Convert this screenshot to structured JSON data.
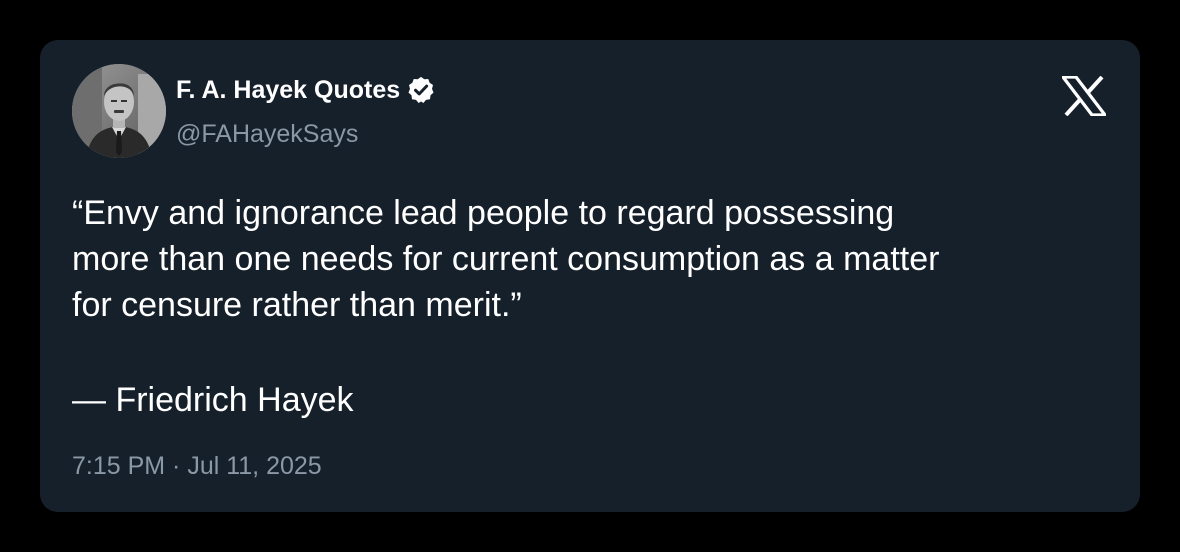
{
  "tweet": {
    "author": {
      "display_name": "F. A. Hayek Quotes",
      "handle": "@FAHayekSays",
      "verified": true,
      "avatar_icon": "profile-photo"
    },
    "brand_icon": "x-logo-icon",
    "quote": "“Envy and ignorance lead people to regard possessing\nmore than one needs for current consumption as a matter\nfor censure rather than merit.”",
    "attribution": "— Friedrich Hayek",
    "timestamp": "7:15 PM · Jul 11, 2025"
  },
  "colors": {
    "page_background": "#000000",
    "card_background": "#15202b",
    "primary_text": "#ffffff",
    "secondary_text": "#8b98a5"
  }
}
